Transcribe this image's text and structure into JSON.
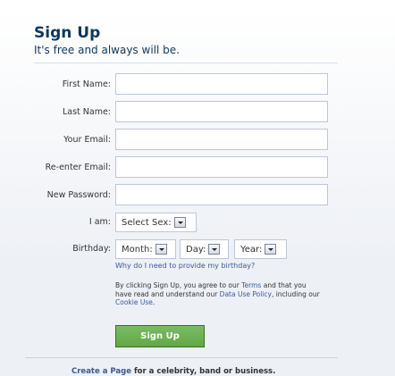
{
  "header": {
    "title": "Sign Up",
    "subtitle": "It's free and always will be."
  },
  "form": {
    "fields": [
      {
        "label": "First Name:",
        "value": "",
        "placeholder": ""
      },
      {
        "label": "Last Name:",
        "value": "",
        "placeholder": ""
      },
      {
        "label": "Your Email:",
        "value": "",
        "placeholder": ""
      },
      {
        "label": "Re-enter Email:",
        "value": "",
        "placeholder": ""
      },
      {
        "label": "New Password:",
        "value": "",
        "placeholder": ""
      }
    ],
    "sex": {
      "label": "I am:",
      "selected": "Select Sex:"
    },
    "birthday": {
      "label": "Birthday:",
      "month": "Month:",
      "day": "Day:",
      "year": "Year:",
      "help_link": "Why do I need to provide my birthday?"
    },
    "legal": {
      "text_1": "By clicking Sign Up, you agree to our ",
      "terms_link": "Terms",
      "text_2": " and that you have read and understand our ",
      "data_policy_link": "Data Use Policy",
      "text_3": ", including our ",
      "cookie_link": "Cookie Use",
      "text_4": "."
    },
    "submit_label": "Sign Up"
  },
  "footer": {
    "create_page_link": "Create a Page",
    "create_page_rest": " for a celebrity, band or business."
  },
  "colors": {
    "heading": "#0e385f",
    "link": "#3b5998",
    "button": "#69a74e",
    "input_border": "#bdc7d8",
    "background": "#edf0f5"
  }
}
